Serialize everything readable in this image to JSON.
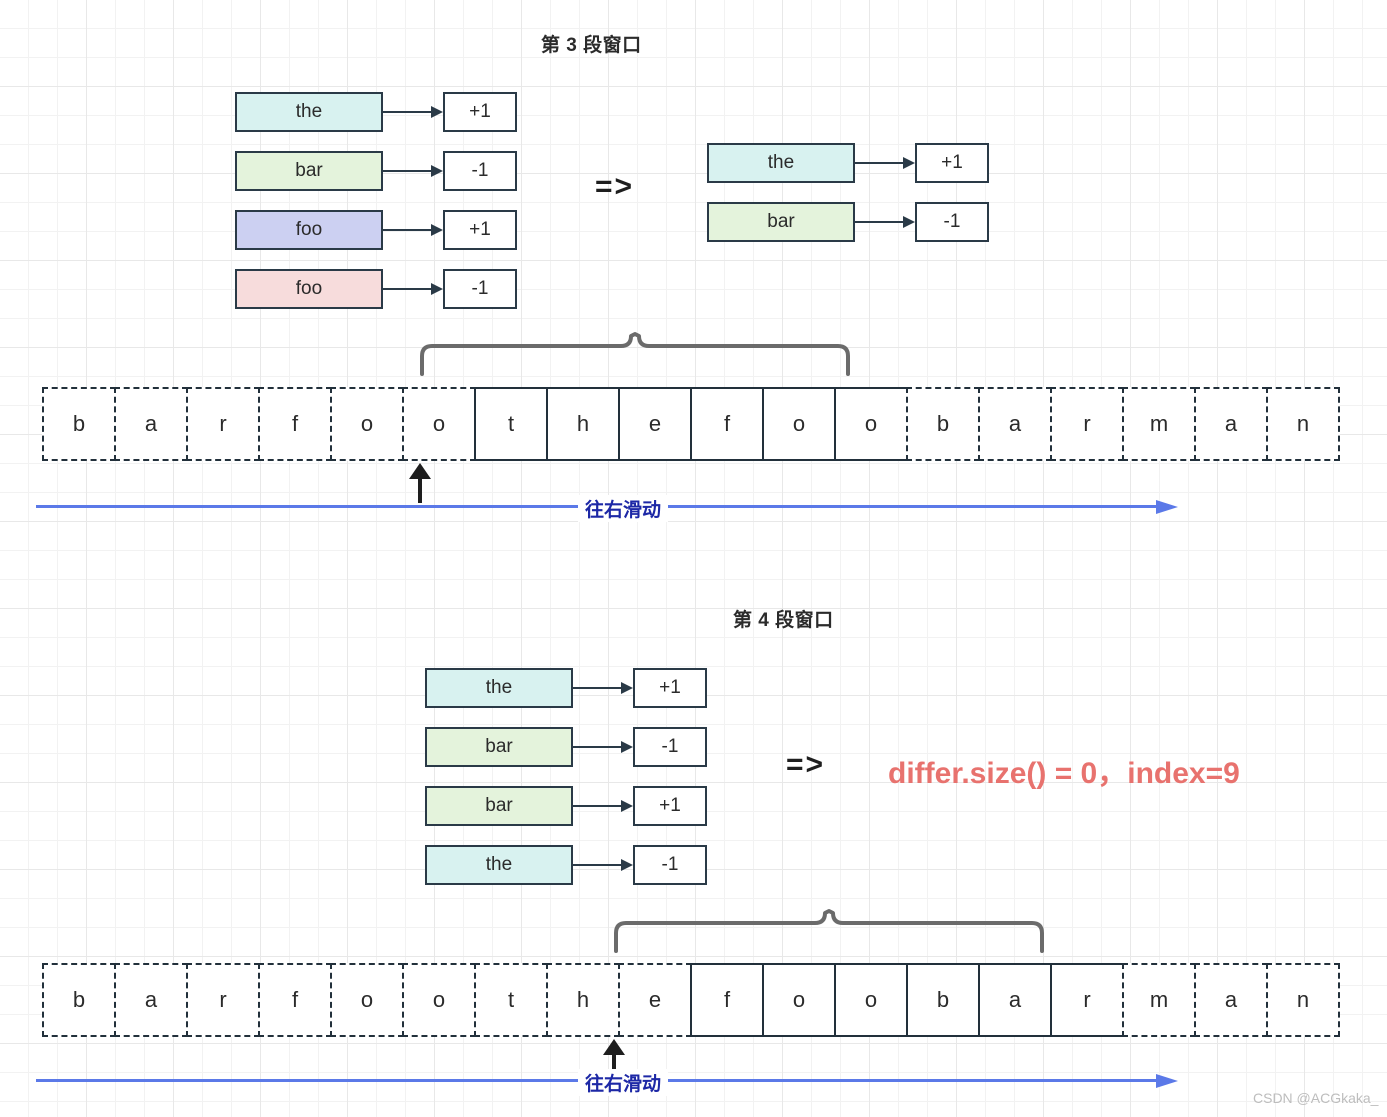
{
  "sections": [
    {
      "title": "第 3 段窗口",
      "left_table": [
        {
          "word": "the",
          "color": "cyan",
          "count": "+1"
        },
        {
          "word": "bar",
          "color": "green",
          "count": "-1"
        },
        {
          "word": "foo",
          "color": "purple",
          "count": "+1"
        },
        {
          "word": "foo",
          "color": "pink",
          "count": "-1"
        }
      ],
      "implies_glyph": "=>",
      "right_table": [
        {
          "word": "the",
          "color": "cyan",
          "count": "+1"
        },
        {
          "word": "bar",
          "color": "green",
          "count": "-1"
        }
      ],
      "strip": [
        {
          "ch": "b",
          "color": "white",
          "style": "dashed"
        },
        {
          "ch": "a",
          "color": "white",
          "style": "dashed"
        },
        {
          "ch": "r",
          "color": "white",
          "style": "dashed"
        },
        {
          "ch": "f",
          "color": "pink",
          "style": "dashed"
        },
        {
          "ch": "o",
          "color": "pink",
          "style": "dashed"
        },
        {
          "ch": "o",
          "color": "pink",
          "style": "dashed"
        },
        {
          "ch": "t",
          "color": "cyan",
          "style": "solid"
        },
        {
          "ch": "h",
          "color": "cyan",
          "style": "solid"
        },
        {
          "ch": "e",
          "color": "cyan",
          "style": "solid"
        },
        {
          "ch": "f",
          "color": "purple",
          "style": "solid"
        },
        {
          "ch": "o",
          "color": "purple",
          "style": "solid"
        },
        {
          "ch": "o",
          "color": "purple",
          "style": "solid"
        },
        {
          "ch": "b",
          "color": "white",
          "style": "dashed"
        },
        {
          "ch": "a",
          "color": "white",
          "style": "dashed"
        },
        {
          "ch": "r",
          "color": "white",
          "style": "dashed"
        },
        {
          "ch": "m",
          "color": "white",
          "style": "dashed"
        },
        {
          "ch": "a",
          "color": "white",
          "style": "dashed"
        },
        {
          "ch": "n",
          "color": "white",
          "style": "dashed"
        }
      ],
      "brace_start_index": 6,
      "brace_end_index": 11,
      "pointer_index": 6,
      "slide_label": "往右滑动",
      "result_text": null
    },
    {
      "title": "第 4 段窗口",
      "left_table": [
        {
          "word": "the",
          "color": "cyan",
          "count": "+1"
        },
        {
          "word": "bar",
          "color": "green",
          "count": "-1"
        },
        {
          "word": "bar",
          "color": "green",
          "count": "+1"
        },
        {
          "word": "the",
          "color": "cyan",
          "count": "-1"
        }
      ],
      "implies_glyph": "=>",
      "right_table": [],
      "result_text": "differ.size() = 0，index=9",
      "strip": [
        {
          "ch": "b",
          "color": "white",
          "style": "dashed"
        },
        {
          "ch": "a",
          "color": "white",
          "style": "dashed"
        },
        {
          "ch": "r",
          "color": "white",
          "style": "dashed"
        },
        {
          "ch": "f",
          "color": "white",
          "style": "dashed"
        },
        {
          "ch": "o",
          "color": "white",
          "style": "dashed"
        },
        {
          "ch": "o",
          "color": "white",
          "style": "dashed"
        },
        {
          "ch": "t",
          "color": "cyan",
          "style": "dashed"
        },
        {
          "ch": "h",
          "color": "cyan",
          "style": "dashed"
        },
        {
          "ch": "e",
          "color": "cyan",
          "style": "dashed"
        },
        {
          "ch": "f",
          "color": "purple",
          "style": "solid"
        },
        {
          "ch": "o",
          "color": "purple",
          "style": "solid"
        },
        {
          "ch": "o",
          "color": "purple",
          "style": "solid"
        },
        {
          "ch": "b",
          "color": "green",
          "style": "solid"
        },
        {
          "ch": "a",
          "color": "green",
          "style": "solid"
        },
        {
          "ch": "r",
          "color": "green",
          "style": "solid"
        },
        {
          "ch": "m",
          "color": "white",
          "style": "dashed"
        },
        {
          "ch": "a",
          "color": "white",
          "style": "dashed"
        },
        {
          "ch": "n",
          "color": "white",
          "style": "dashed"
        }
      ],
      "brace_start_index": 9,
      "brace_end_index": 14,
      "pointer_index": 9,
      "slide_label": "往右滑动"
    }
  ],
  "watermark": "CSDN @ACGkaka_",
  "colors": {
    "cyan": "#d8f2f0",
    "green": "#e4f3dc",
    "purple": "#ccd0f2",
    "pink": "#f7dcdc",
    "white": "#ffffff",
    "box_border": "#2a3a47",
    "accent_blue": "#5b79e8",
    "result_red": "#e8726e",
    "slide_label": "#1d28a6"
  }
}
